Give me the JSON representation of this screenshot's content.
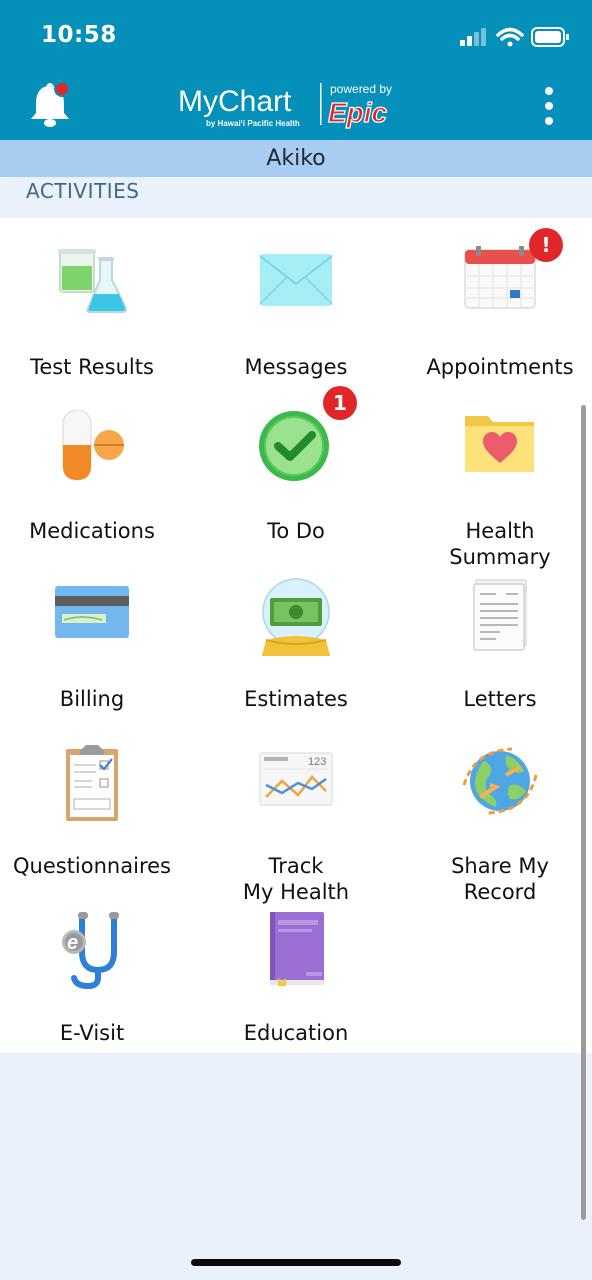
{
  "status_bar": {
    "time": "10:58"
  },
  "header": {
    "logo_text": "MyChart",
    "logo_sub": "by Hawai‘i Pacific Health",
    "powered_by": "powered by",
    "powered_brand": "Epic",
    "notification_badge_visible": true
  },
  "patient_name": "Akiko",
  "section_title": "ACTIVITIES",
  "colors": {
    "brand": "#0590b9",
    "name_bar": "#a9cdf0",
    "badge": "#e1262a",
    "background": "#eaf1fa"
  },
  "activities": [
    {
      "label": "Test Results",
      "icon": "test-tubes-icon"
    },
    {
      "label": "Messages",
      "icon": "envelope-icon"
    },
    {
      "label": "Appointments",
      "icon": "calendar-icon",
      "badge": "!"
    },
    {
      "label": "Medications",
      "icon": "pills-icon"
    },
    {
      "label": "To Do",
      "icon": "check-clock-icon",
      "badge": "1"
    },
    {
      "label": "Health\nSummary",
      "icon": "heart-folder-icon"
    },
    {
      "label": "Billing",
      "icon": "credit-card-icon"
    },
    {
      "label": "Estimates",
      "icon": "money-globe-icon"
    },
    {
      "label": "Letters",
      "icon": "document-icon"
    },
    {
      "label": "Questionnaires",
      "icon": "clipboard-icon"
    },
    {
      "label": "Track\nMy Health",
      "icon": "line-graph-icon",
      "icon_text": "123"
    },
    {
      "label": "Share My\nRecord",
      "icon": "globe-share-icon"
    },
    {
      "label": "E-Visit",
      "icon": "stethoscope-icon",
      "icon_text": "e"
    },
    {
      "label": "Education",
      "icon": "book-icon"
    }
  ]
}
